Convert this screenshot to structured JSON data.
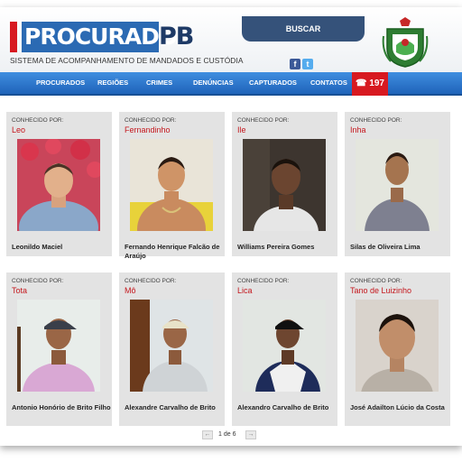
{
  "header": {
    "logo_main": "PROCURADOS",
    "logo_suffix": "PB",
    "subtitle": "SISTEMA DE ACOMPANHAMENTO DE MANDADOS E CUSTÓDIA",
    "search_label": "BUSCAR",
    "facebook_icon": "f",
    "twitter_icon": "t",
    "crest": "paraiba-coat-of-arms-icon"
  },
  "nav": {
    "items": [
      "PROCURADOS",
      "REGIÕES",
      "CRIMES",
      "DENÚNCIAS",
      "CAPTURADOS",
      "CONTATOS"
    ],
    "call_label": "☎ 197"
  },
  "card_caption": "CONHECIDO POR:",
  "cards": [
    {
      "alias": "Leo",
      "name": "Leonildo Maciel"
    },
    {
      "alias": "Fernandinho",
      "name": "Fernando Henrique Falcão de Araújo"
    },
    {
      "alias": "Ile",
      "name": "Williams Pereira Gomes"
    },
    {
      "alias": "Inha",
      "name": "Silas de Oliveira Lima"
    },
    {
      "alias": "Tota",
      "name": "Antonio Honório de Brito Filho"
    },
    {
      "alias": "Mô",
      "name": "Alexandre Carvalho de Brito"
    },
    {
      "alias": "Lica",
      "name": "Alexandro Carvalho de Brito"
    },
    {
      "alias": "Tano de Luizinho",
      "name": "José Adailton Lúcio da Costa"
    }
  ],
  "pagination": {
    "prev": "←",
    "label": "1 de 6",
    "next": "→"
  },
  "colors": {
    "accent_red": "#d71920",
    "nav_blue": "#1f63b9",
    "card_bg": "#e3e3e3",
    "alias_red": "#c4161c"
  }
}
